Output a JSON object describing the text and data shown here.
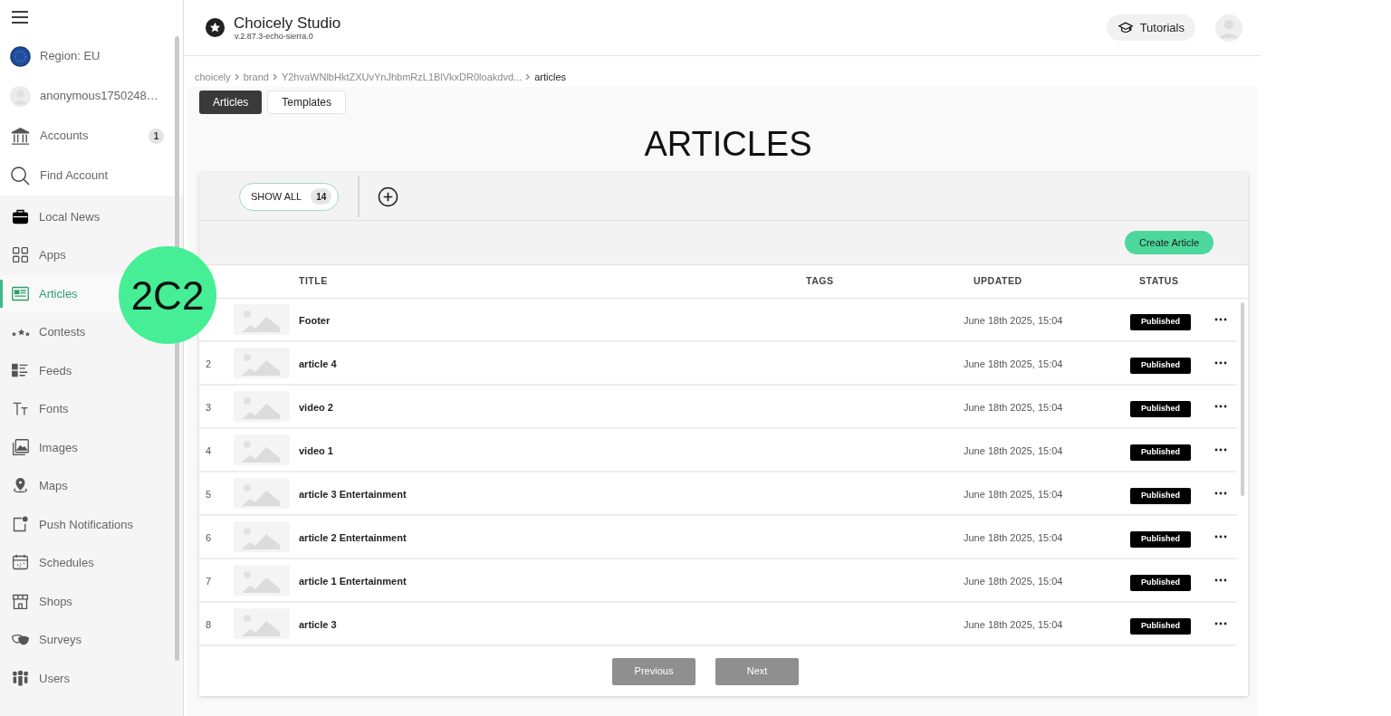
{
  "sidebar": {
    "account_items": [
      {
        "kind": "region",
        "label": "Region: EU"
      },
      {
        "kind": "user",
        "label": "anonymous1750248…"
      },
      {
        "kind": "accounts",
        "label": "Accounts",
        "badge": "1"
      },
      {
        "kind": "find",
        "label": "Find Account"
      }
    ],
    "nav_items": [
      {
        "label": "Local News",
        "selected": false
      },
      {
        "label": "Apps",
        "selected": false
      },
      {
        "label": "Articles",
        "selected": true
      },
      {
        "label": "Contests",
        "selected": false
      },
      {
        "label": "Feeds",
        "selected": false
      },
      {
        "label": "Fonts",
        "selected": false
      },
      {
        "label": "Images",
        "selected": false
      },
      {
        "label": "Maps",
        "selected": false
      },
      {
        "label": "Push Notifications",
        "selected": false
      },
      {
        "label": "Schedules",
        "selected": false
      },
      {
        "label": "Shops",
        "selected": false
      },
      {
        "label": "Surveys",
        "selected": false
      },
      {
        "label": "Users",
        "selected": false
      }
    ]
  },
  "header": {
    "title": "Choicely Studio",
    "version": "v.2.87.3-echo-sierra.0",
    "tutorials": "Tutorials"
  },
  "breadcrumb": [
    "choicely",
    "brand",
    "Y2hvaWNlbHktZXUvYnJhbmRzL1BlVkxDR0loakdvd...",
    "articles"
  ],
  "tabs": [
    {
      "label": "Articles",
      "selected": true
    },
    {
      "label": "Templates",
      "selected": false
    }
  ],
  "page_title": "ARTICLES",
  "filter": {
    "label": "SHOW ALL",
    "count": "14"
  },
  "create_button": "Create Article",
  "table": {
    "columns": [
      "TITLE",
      "TAGS",
      "UPDATED",
      "STATUS"
    ],
    "rows": [
      {
        "number": "",
        "title": "Footer",
        "updated": "June 18th 2025, 15:04",
        "status": "Published"
      },
      {
        "number": "2",
        "title": "article 4",
        "updated": "June 18th 2025, 15:04",
        "status": "Published"
      },
      {
        "number": "3",
        "title": "video 2",
        "updated": "June 18th 2025, 15:04",
        "status": "Published"
      },
      {
        "number": "4",
        "title": "video 1",
        "updated": "June 18th 2025, 15:04",
        "status": "Published"
      },
      {
        "number": "5",
        "title": "article 3 Entertainment",
        "updated": "June 18th 2025, 15:04",
        "status": "Published"
      },
      {
        "number": "6",
        "title": "article 2 Entertainment",
        "updated": "June 18th 2025, 15:04",
        "status": "Published"
      },
      {
        "number": "7",
        "title": "article 1 Entertainment",
        "updated": "June 18th 2025, 15:04",
        "status": "Published"
      },
      {
        "number": "8",
        "title": "article 3",
        "updated": "June 18th 2025, 15:04",
        "status": "Published"
      }
    ]
  },
  "pagination": [
    {
      "label": "Previous",
      "disabled": true
    },
    {
      "label": "Next",
      "disabled": true
    }
  ],
  "annotation": "2C2"
}
